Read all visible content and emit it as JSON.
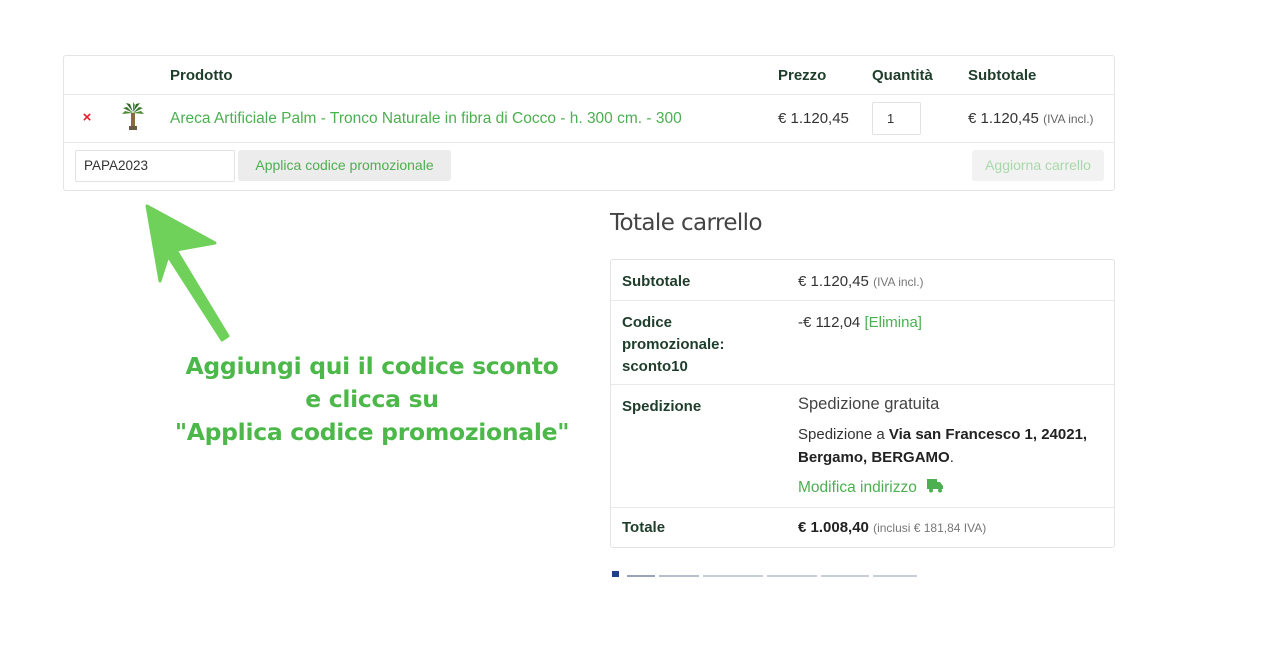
{
  "cart": {
    "headers": {
      "product": "Prodotto",
      "price": "Prezzo",
      "quantity": "Quantità",
      "subtotal": "Subtotale"
    },
    "items": [
      {
        "remove_glyph": "×",
        "thumbnail_icon": "palm-tree-icon",
        "name": "Areca Artificiale Palm - Tronco Naturale in fibra di Cocco - h. 300 cm. - 300",
        "price": "€ 1.120,45",
        "quantity": "1",
        "subtotal": "€ 1.120,45",
        "tax_note": "(IVA incl.)"
      }
    ],
    "coupon": {
      "value": "PAPA2023",
      "apply_label": "Applica codice promozionale"
    },
    "update_label": "Aggiorna carrello"
  },
  "totals": {
    "title": "Totale carrello",
    "subtotal_label": "Subtotale",
    "subtotal_value": "€ 1.120,45",
    "subtotal_tax_note": "(IVA incl.)",
    "coupon_label_line1": "Codice",
    "coupon_label_line2": "promozionale:",
    "coupon_label_line3": "sconto10",
    "coupon_value": "-€ 112,04",
    "coupon_remove": "[Elimina]",
    "shipping_label": "Spedizione",
    "shipping_method": "Spedizione gratuita",
    "shipping_dest_prefix": "Spedizione a",
    "shipping_address": "Via san Francesco 1, 24021, Bergamo, BERGAMO",
    "shipping_dest_suffix": ".",
    "modify_address": "Modifica indirizzo",
    "total_label": "Totale",
    "total_value": "€ 1.008,40",
    "total_tax_note": "(inclusi € 181,84 IVA)"
  },
  "annotation": {
    "line1": "Aggiungi qui il codice sconto",
    "line2": "e clicca su",
    "line3": "\"Applica codice promozionale\""
  },
  "colors": {
    "accent_green": "#4caf50",
    "annotation_green": "#4db84a",
    "arrow_green": "#6fd15a",
    "remove_red": "#e0202e",
    "heading_dark": "#1f3d2b"
  }
}
